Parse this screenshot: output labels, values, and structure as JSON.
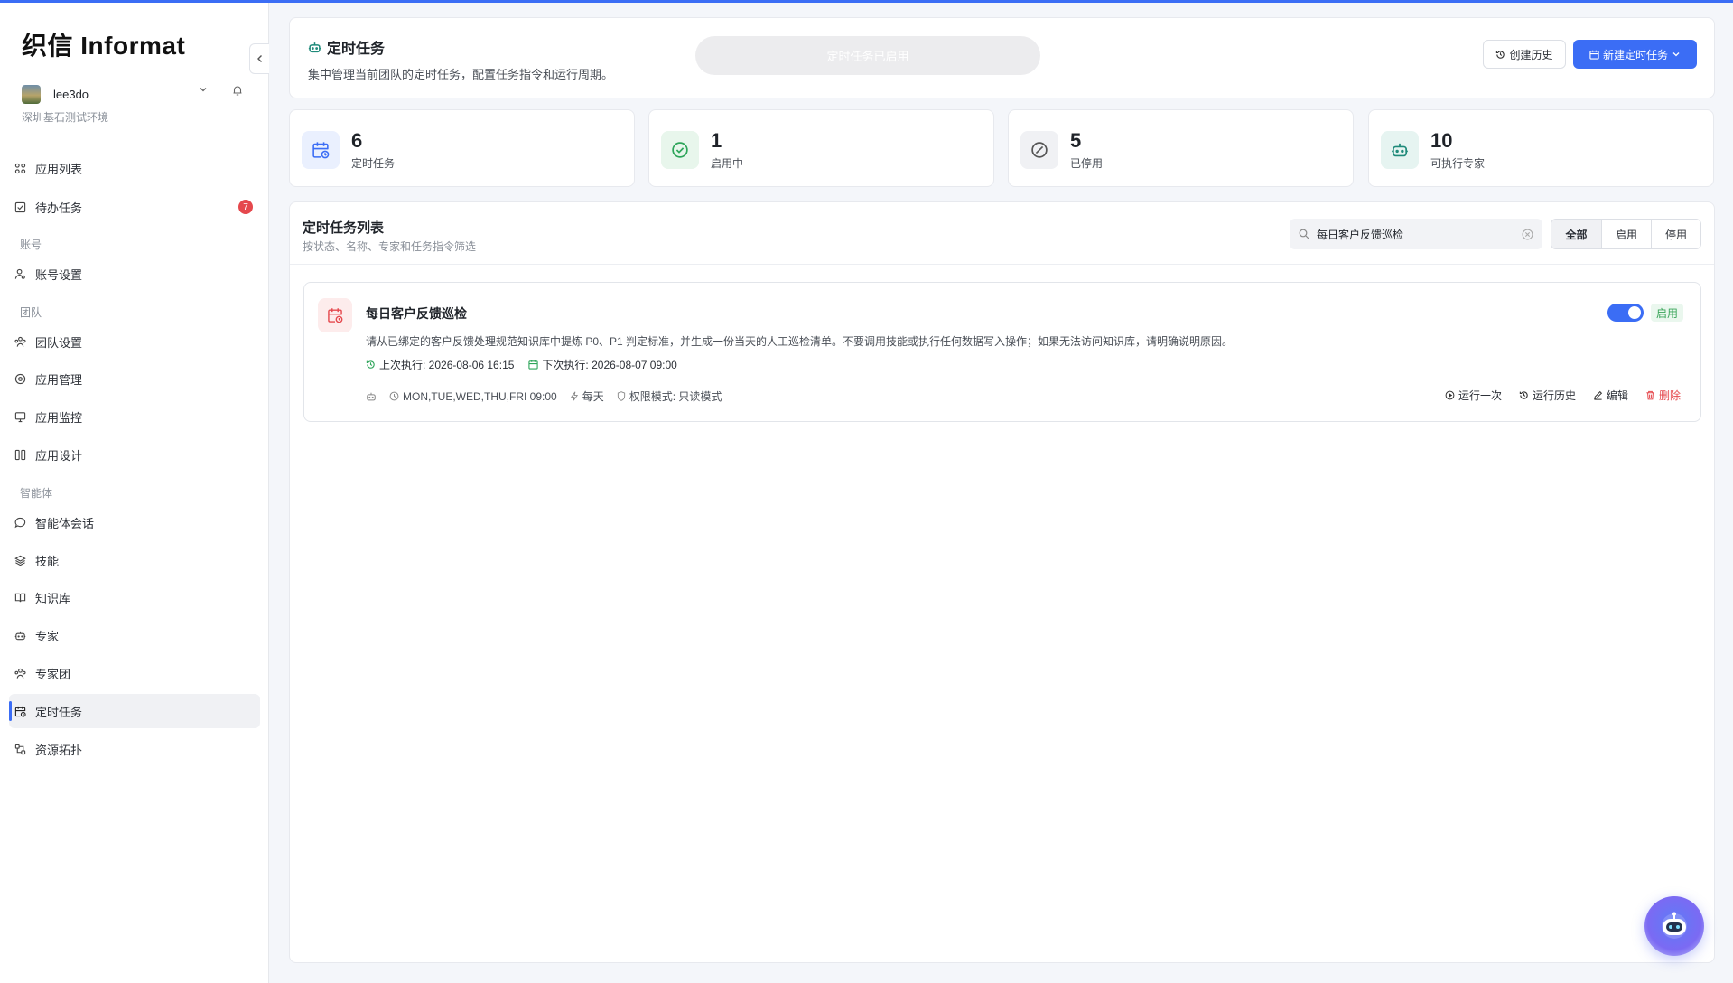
{
  "brand": {
    "logo": "织信 Informat"
  },
  "user": {
    "name": "lee3do",
    "env": "深圳基石测试环境"
  },
  "sidebar": {
    "items": [
      {
        "label": "应用列表"
      },
      {
        "label": "待办任务",
        "badge": "7"
      },
      {
        "group": "账号"
      },
      {
        "label": "账号设置"
      },
      {
        "group": "团队"
      },
      {
        "label": "团队设置"
      },
      {
        "label": "应用管理"
      },
      {
        "label": "应用监控"
      },
      {
        "label": "应用设计"
      },
      {
        "group": "智能体"
      },
      {
        "label": "智能体会话"
      },
      {
        "label": "技能"
      },
      {
        "label": "知识库"
      },
      {
        "label": "专家"
      },
      {
        "label": "专家团"
      },
      {
        "label": "定时任务"
      },
      {
        "label": "资源拓扑"
      }
    ]
  },
  "header": {
    "title": "定时任务",
    "description": "集中管理当前团队的定时任务，配置任务指令和运行周期。",
    "pill": "定时任务已启用",
    "history_btn": "创建历史",
    "new_btn": "新建定时任务"
  },
  "stats": [
    {
      "value": "6",
      "label": "定时任务",
      "color": "#3b6df5"
    },
    {
      "value": "1",
      "label": "启用中",
      "color": "#2ea55a"
    },
    {
      "value": "5",
      "label": "已停用",
      "color": "#6b7079"
    },
    {
      "value": "10",
      "label": "可执行专家",
      "color": "#1f8a7a"
    }
  ],
  "list": {
    "title": "定时任务列表",
    "subtitle": "按状态、名称、专家和任务指令筛选",
    "search_value": "每日客户反馈巡检",
    "filters": [
      "全部",
      "启用",
      "停用"
    ]
  },
  "task": {
    "name": "每日客户反馈巡检",
    "description": "请从已绑定的客户反馈处理规范知识库中提炼 P0、P1 判定标准，并生成一份当天的人工巡检清单。不要调用技能或执行任何数据写入操作；如果无法访问知识库，请明确说明原因。",
    "last_run": "上次执行: 2026-08-06 16:15",
    "next_run": "下次执行: 2026-08-07 09:00",
    "cron": "MON,TUE,WED,THU,FRI 09:00",
    "frequency": "每天",
    "permission": "权限模式: 只读模式",
    "status": "启用",
    "enabled": true,
    "actions": {
      "run_once": "运行一次",
      "history": "运行历史",
      "edit": "编辑",
      "delete": "删除"
    }
  },
  "colors": {
    "accent": "#3b6df5",
    "danger": "#e5484d",
    "success": "#3aa55a"
  }
}
